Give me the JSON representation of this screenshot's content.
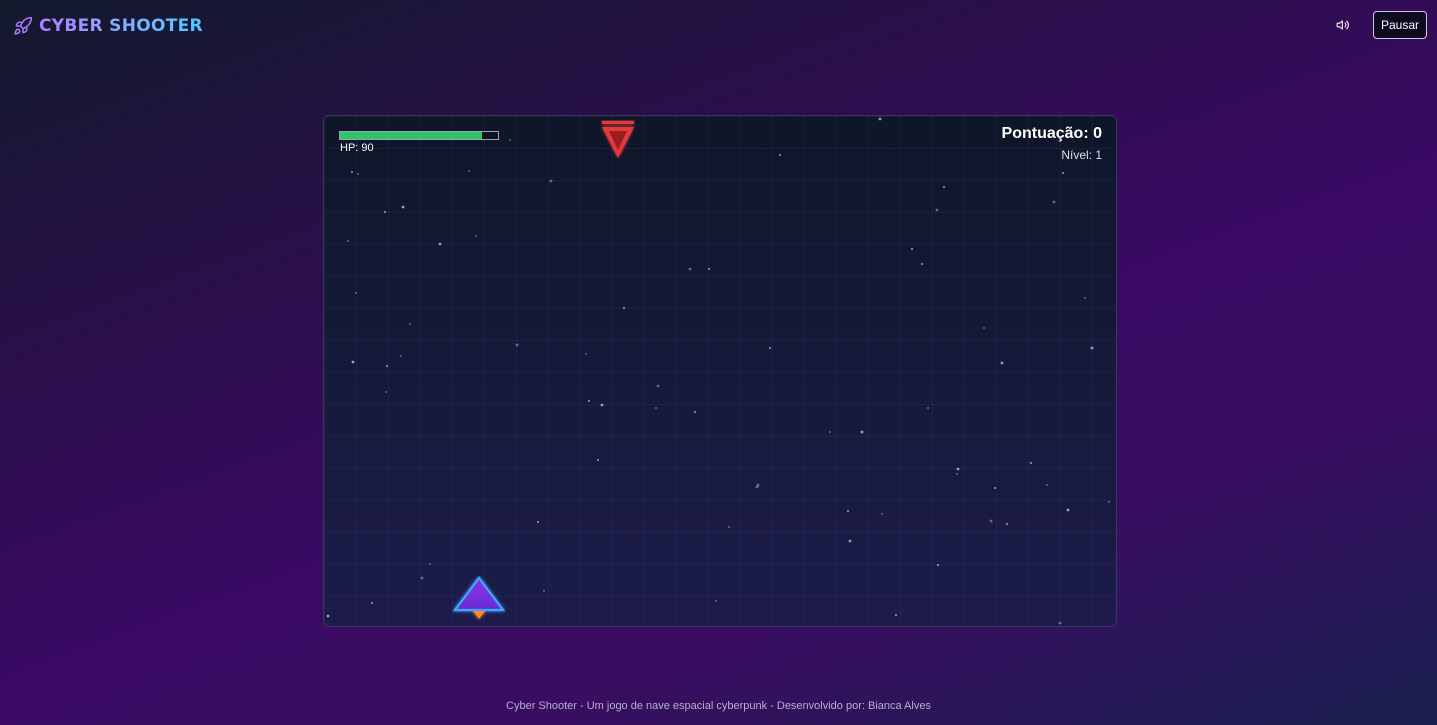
{
  "app": {
    "title": "CYBER SHOOTER",
    "logo_icon": "rocket-icon"
  },
  "header": {
    "sound_icon": "speaker-icon",
    "pause_label": "Pausar"
  },
  "hud": {
    "hp_label": "HP: 90",
    "hp_fraction": 0.9,
    "score_label": "Pontuação: 0",
    "level_label": "Nível: 1"
  },
  "entities": {
    "enemy": "red-triangle-enemy-ship",
    "player": "blue-purple-triangle-player-ship"
  },
  "colors": {
    "accent_purple": "#b57bff",
    "accent_cyan": "#4fc8ff",
    "hp_green": "#2ec46a",
    "enemy_red": "#e23b3b",
    "player_purple": "#8a35e6",
    "player_blue": "#3da8ff"
  },
  "footer": {
    "text": "Cyber Shooter - Um jogo de nave espacial cyberpunk - Desenvolvido por: Bianca Alves"
  }
}
